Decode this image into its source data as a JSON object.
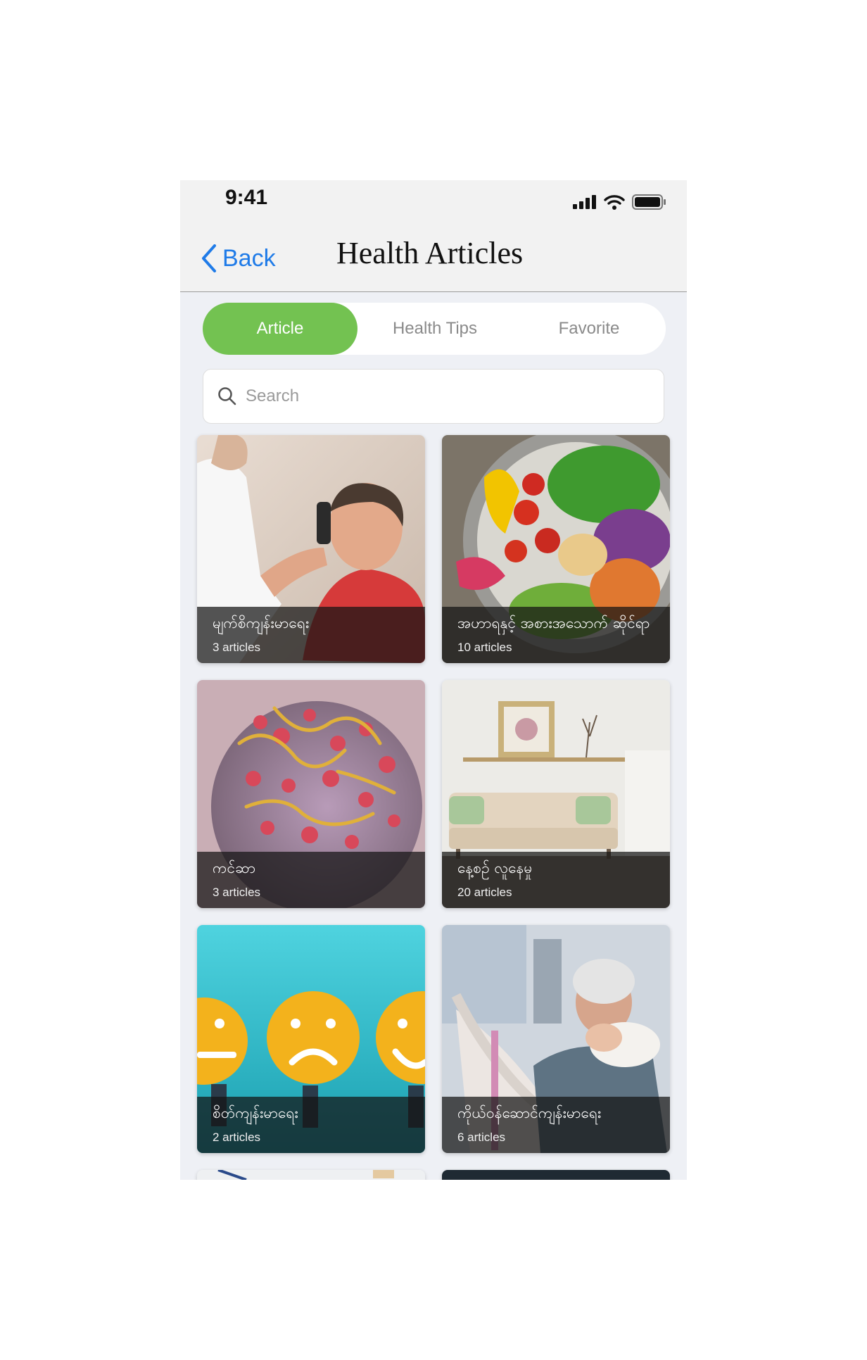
{
  "status_bar": {
    "time": "9:41"
  },
  "nav": {
    "back_label": "Back",
    "title": "Health Articles"
  },
  "tabs": [
    {
      "label": "Article",
      "active": true
    },
    {
      "label": "Health Tips",
      "active": false
    },
    {
      "label": "Favorite",
      "active": false
    }
  ],
  "search": {
    "placeholder": "Search",
    "value": ""
  },
  "colors": {
    "accent_green": "#73c251",
    "link_blue": "#1f7be8",
    "background": "#eef0f5"
  },
  "categories": [
    {
      "name": "မျက်စိကျန်းမာရေး",
      "count": "3 articles",
      "image": "eye-exam-photo"
    },
    {
      "name": "အဟာရနှင့် အစားအသောက် ဆိုင်ရာ",
      "count": "10 articles",
      "image": "salad-bowl-photo"
    },
    {
      "name": "ကင်ဆာ",
      "count": "3 articles",
      "image": "cancer-cell-illustration"
    },
    {
      "name": "နေ့စဉ် လူနေမှု",
      "count": "20 articles",
      "image": "living-room-photo"
    },
    {
      "name": "စိတ်ကျန်းမာရေး",
      "count": "2 articles",
      "image": "emoji-faces-photo"
    },
    {
      "name": "ကိုယ်ဝန်ဆောင်ကျန်းမာရေး",
      "count": "6 articles",
      "image": "mother-newborn-photo"
    }
  ]
}
